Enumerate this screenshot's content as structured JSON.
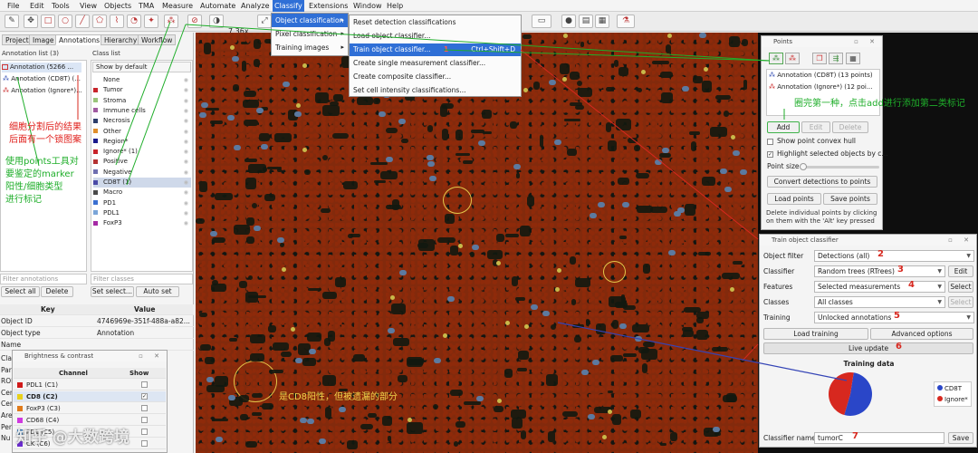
{
  "menubar": {
    "items": [
      "File",
      "Edit",
      "Tools",
      "View",
      "Objects",
      "TMA",
      "Measure",
      "Automate",
      "Analyze",
      "Classify",
      "Extensions",
      "Window",
      "Help"
    ],
    "active": "Classify"
  },
  "toolbar": {
    "zoom": "7.36x"
  },
  "classify_menu": {
    "items": [
      "Object classification",
      "Pixel classification",
      "Training images"
    ]
  },
  "object_classification_menu": {
    "items": [
      "Reset detection classifications",
      "Load object classifier...",
      "Train object classifier...",
      "Create single measurement classifier...",
      "Create composite classifier...",
      "Set cell intensity classifications..."
    ],
    "shortcut": "Ctrl+Shift+D",
    "step_number": "1"
  },
  "left_panel": {
    "tabs": [
      "Project",
      "Image",
      "Annotations",
      "Hierarchy",
      "Workflow"
    ],
    "annotation_list_label": "Annotation list (3)",
    "class_list_label": "Class list",
    "annotations": [
      "Annotation (5266 ...",
      "Annotation (CD8T) (...",
      "Annotation (Ignore*)..."
    ],
    "show_by_default": "Show by default",
    "classes": [
      {
        "name": "None",
        "color": "#ffffff"
      },
      {
        "name": "Tumor",
        "color": "#c8242b"
      },
      {
        "name": "Stroma",
        "color": "#99c47a"
      },
      {
        "name": "Immune cells",
        "color": "#a05aa0"
      },
      {
        "name": "Necrosis",
        "color": "#2c3d6b"
      },
      {
        "name": "Other",
        "color": "#e08e2a"
      },
      {
        "name": "Region*",
        "color": "#1a1a8c"
      },
      {
        "name": "Ignore* (1)",
        "color": "#c8242b"
      },
      {
        "name": "Positive",
        "color": "#b43232"
      },
      {
        "name": "Negative",
        "color": "#6f6fb0"
      },
      {
        "name": "CD8T (1)",
        "color": "#4a4aa6"
      },
      {
        "name": "Macro",
        "color": "#4a4a4a"
      },
      {
        "name": "PD1",
        "color": "#3a6fd0"
      },
      {
        "name": "PDL1",
        "color": "#7aa5d8"
      },
      {
        "name": "FoxP3",
        "color": "#a52aa5"
      }
    ],
    "filter_annotations_placeholder": "Filter annotations",
    "filter_classes_placeholder": "Filter classes",
    "select_all": "Select all",
    "delete": "Delete",
    "set_select": "Set select...",
    "auto_set": "Auto set",
    "props_header": {
      "key": "Key",
      "value": "Value"
    },
    "props": [
      {
        "key": "Object ID",
        "value": "4746969e-351f-488a-a82..."
      },
      {
        "key": "Object type",
        "value": "Annotation"
      },
      {
        "key": "Name",
        "value": ""
      }
    ]
  },
  "brightness_contrast": {
    "title": "Brightness & contrast",
    "header": {
      "channel": "Channel",
      "show": "Show"
    },
    "channels": [
      {
        "name": "PDL1 (C1)",
        "color": "#d01a1a",
        "show": false
      },
      {
        "name": "CD8 (C2)",
        "color": "#e8d01a",
        "show": true
      },
      {
        "name": "FoxP3 (C3)",
        "color": "#e07a1a",
        "show": false
      },
      {
        "name": "CD68 (C4)",
        "color": "#d03adf",
        "show": false
      },
      {
        "name": "PD1 (C5)",
        "color": "#1a7ad0",
        "show": false
      },
      {
        "name": "CK (C6)",
        "color": "#6a2ad0",
        "show": false
      }
    ],
    "side_keys": [
      "Cla",
      "Par",
      "ROI",
      "Cen",
      "Cen",
      "Are",
      "Per",
      "Nu"
    ]
  },
  "points_panel": {
    "title": "Points",
    "entries": [
      "Annotation (CD8T) (13 points)",
      "Annotation (Ignore*) (12 poi..."
    ],
    "add": "Add",
    "edit": "Edit",
    "delete": "Delete",
    "show_convex_hull": "Show point convex hull",
    "highlight_selected": "Highlight selected objects by c...",
    "point_size": "Point size",
    "convert": "Convert detections to points",
    "load_points": "Load points",
    "save_points": "Save points",
    "help_text": "Delete individual points by clicking on them with the 'Alt' key pressed"
  },
  "train_classifier": {
    "title": "Train object classifier",
    "rows": [
      {
        "label": "Object filter",
        "value": "Detections (all)",
        "num": "2"
      },
      {
        "label": "Classifier",
        "value": "Random trees (RTrees)",
        "num": "3",
        "button": "Edit"
      },
      {
        "label": "Features",
        "value": "Selected measurements",
        "num": "4",
        "button": "Select"
      },
      {
        "label": "Classes",
        "value": "All classes",
        "button": "Select"
      },
      {
        "label": "Training",
        "value": "Unlocked annotations",
        "num": "5"
      }
    ],
    "load_training": "Load training",
    "advanced_options": "Advanced options",
    "live_update": "Live update",
    "live_num": "6",
    "training_data_title": "Training data",
    "legend": [
      {
        "name": "CD8T",
        "color": "#2a46c8"
      },
      {
        "name": "Ignore*",
        "color": "#d7281f"
      }
    ],
    "classifier_name_label": "Classifier name",
    "classifier_name_value": "tumorC",
    "classifier_name_num": "7",
    "save": "Save"
  },
  "chart_data": {
    "type": "pie",
    "title": "Training data",
    "categories": [
      "CD8T",
      "Ignore*"
    ],
    "values": [
      13,
      12
    ],
    "colors": [
      "#2a46c8",
      "#d7281f"
    ]
  },
  "annotations": {
    "note_segment": "细胞分割后的结果\n后面有一个锁图案",
    "note_points": "使用points工具对\n要鉴定的marker\n阳性/细胞类型\n进行标记",
    "note_add": "圈完第一种，点击add进行添加第二类标记",
    "note_missed": "是CD8阳性，但被遗漏的部分",
    "watermark": "知乎 @大数跨境"
  }
}
